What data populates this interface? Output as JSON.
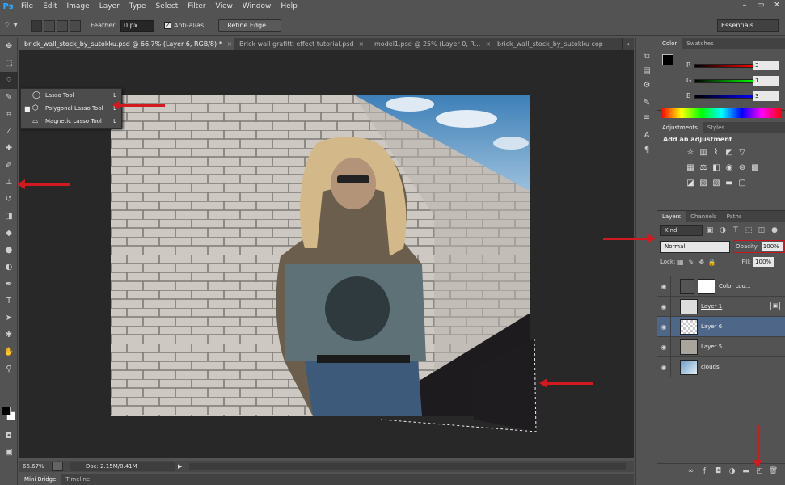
{
  "app": {
    "logo": "Ps"
  },
  "menu": [
    "File",
    "Edit",
    "Image",
    "Layer",
    "Type",
    "Select",
    "Filter",
    "View",
    "Window",
    "Help"
  ],
  "window_controls": [
    "–",
    "▭",
    "✕"
  ],
  "options_bar": {
    "feather_label": "Feather:",
    "feather_value": "0 px",
    "antialias_label": "Anti-alias",
    "refine_button": "Refine Edge...",
    "workspace": "Essentials"
  },
  "flyout": {
    "items": [
      {
        "label": "Lasso Tool",
        "key": "L"
      },
      {
        "label": "Polygonal Lasso Tool",
        "key": "L"
      },
      {
        "label": "Magnetic Lasso Tool",
        "key": "L"
      }
    ]
  },
  "doc_tabs": [
    "brick_wall_stock_by_sutokku.psd @ 66.7% (Layer 6, RGB/8) *",
    "Brick wall grafitti effect tutorial.psd",
    "model1.psd @ 25% (Layer 0, R...",
    "brick_wall_stock_by_sutokku cop"
  ],
  "status": {
    "zoom": "66.67%",
    "doc": "Doc: 2.15M/8.41M"
  },
  "bottom_tabs": [
    "Mini Bridge",
    "Timeline"
  ],
  "color_panel": {
    "tabs": [
      "Color",
      "Swatches"
    ],
    "channels": [
      {
        "label": "R",
        "value": "3"
      },
      {
        "label": "G",
        "value": "1"
      },
      {
        "label": "B",
        "value": "3"
      }
    ]
  },
  "adjustments": {
    "tabs": [
      "Adjustments",
      "Styles"
    ],
    "title": "Add an adjustment"
  },
  "layers_panel": {
    "tabs": [
      "Layers",
      "Channels",
      "Paths"
    ],
    "kind": "Kind",
    "blend_mode": "Normal",
    "opacity_label": "Opacity:",
    "opacity_value": "100%",
    "lock_label": "Lock:",
    "fill_label": "Fill:",
    "fill_value": "100%",
    "layers": [
      {
        "name": "Color Loo..."
      },
      {
        "name": "Layer 1"
      },
      {
        "name": "Layer 6"
      },
      {
        "name": "Layer 5"
      },
      {
        "name": "clouds"
      }
    ]
  },
  "colors": {
    "accent_red": "#d11a1f",
    "selection_blue": "#4e6688"
  }
}
